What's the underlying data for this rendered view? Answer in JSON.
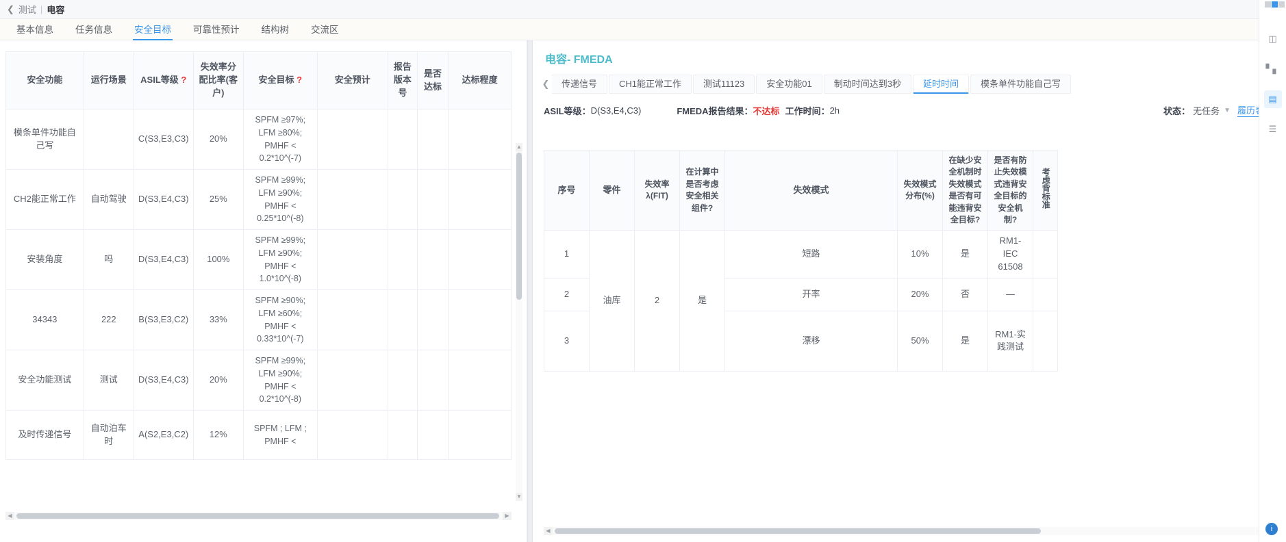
{
  "breadcrumb": {
    "back_icon": "chevron-left-icon",
    "parent": "测试",
    "sep": "|",
    "current": "电容"
  },
  "main_tabs": [
    {
      "label": "基本信息",
      "active": false
    },
    {
      "label": "任务信息",
      "active": false
    },
    {
      "label": "安全目标",
      "active": true
    },
    {
      "label": "可靠性预计",
      "active": false
    },
    {
      "label": "结构树",
      "active": false
    },
    {
      "label": "交流区",
      "active": false
    }
  ],
  "left_table": {
    "headers": [
      {
        "label": "安全功能",
        "help": false
      },
      {
        "label": "运行场景",
        "help": false
      },
      {
        "label": "ASIL等级",
        "help": true
      },
      {
        "label": "失效率分配比率(客户)",
        "help": false
      },
      {
        "label": "安全目标",
        "help": true
      },
      {
        "label": "安全预计",
        "help": false
      },
      {
        "label": "报告版本号",
        "help": false
      },
      {
        "label": "是否达标",
        "help": false
      },
      {
        "label": "达标程度",
        "help": false
      }
    ],
    "help_glyph": "?",
    "rows": [
      {
        "func": "模条单件功能自己写",
        "scene": "",
        "asil": "C(S3,E3,C3)",
        "ratio": "20%",
        "goal": "SPFM ≥97%; LFM ≥80%; PMHF < 0.2*10^(-7)",
        "estimate": "",
        "version": "",
        "pass": "",
        "degree": ""
      },
      {
        "func": "CH2能正常工作",
        "scene": "自动驾驶",
        "asil": "D(S3,E4,C3)",
        "ratio": "25%",
        "goal": "SPFM ≥99%; LFM ≥90%; PMHF < 0.25*10^(-8)",
        "estimate": "",
        "version": "",
        "pass": "",
        "degree": ""
      },
      {
        "func": "安装角度",
        "scene": "吗",
        "asil": "D(S3,E4,C3)",
        "ratio": "100%",
        "goal": "SPFM ≥99%; LFM ≥90%; PMHF < 1.0*10^(-8)",
        "estimate": "",
        "version": "",
        "pass": "",
        "degree": ""
      },
      {
        "func": "34343",
        "scene": "222",
        "asil": "B(S3,E3,C2)",
        "ratio": "33%",
        "goal": "SPFM ≥90%; LFM ≥60%; PMHF < 0.33*10^(-7)",
        "estimate": "",
        "version": "",
        "pass": "",
        "degree": ""
      },
      {
        "func": "安全功能测试",
        "scene": "测试",
        "asil": "D(S3,E4,C3)",
        "ratio": "20%",
        "goal": "SPFM ≥99%; LFM ≥90%; PMHF < 0.2*10^(-8)",
        "estimate": "",
        "version": "",
        "pass": "",
        "degree": ""
      },
      {
        "func": "及时传递信号",
        "scene": "自动泊车时",
        "asil": "A(S2,E3,C2)",
        "ratio": "12%",
        "goal": "SPFM ; LFM ; PMHF <",
        "estimate": "",
        "version": "",
        "pass": "",
        "degree": ""
      }
    ],
    "vscroll": {
      "up_icon": "caret-up-icon",
      "down_icon": "caret-down-icon"
    },
    "hscroll": {
      "left_icon": "caret-left-icon",
      "right_icon": "caret-right-icon"
    }
  },
  "right_panel": {
    "title": "电容- FMEDA",
    "tabs_prev_icon": "chevron-left-icon",
    "tabs_next_icon": "chevron-right-icon",
    "tabs": [
      {
        "label": "传递信号",
        "active": false,
        "clipped": true
      },
      {
        "label": "CH1能正常工作",
        "active": false
      },
      {
        "label": "测试11123",
        "active": false
      },
      {
        "label": "安全功能01",
        "active": false
      },
      {
        "label": "制动时间达到3秒",
        "active": false
      },
      {
        "label": "延时时间",
        "active": true
      },
      {
        "label": "模条单件功能自己写",
        "active": false
      }
    ],
    "meta": {
      "asil_label": "ASIL等级：",
      "asil_value": "D(S3,E4,C3)",
      "fmeda_label": "FMEDA报告结果：",
      "fmeda_value": "不达标",
      "worktime_label": "工作时间：",
      "worktime_value": "2h",
      "status_label": "状态：",
      "status_value": "无任务",
      "status_caret_icon": "chevron-down-icon",
      "history_link": "履历表"
    },
    "collapse_icon": "caret-up-circle-icon",
    "table": {
      "headers": [
        "序号",
        "零件",
        "失效率λ(FIT)",
        "在计算中是否考虑安全相关组件?",
        "失效模式",
        "失效模式分布(%)",
        "在缺少安全机制时失效模式是否有可能违背安全目标?",
        "是否有防止失效模式违背安全目标的安全机制?",
        "考虑背标准"
      ],
      "rows": [
        {
          "idx": "1",
          "part": "油库",
          "fit": "2",
          "consider": "是",
          "mode": "短路",
          "dist": "10%",
          "violate": "是",
          "mechanism": "RM1-IEC 61508",
          "extra": ""
        },
        {
          "idx": "2",
          "part": "",
          "fit": "",
          "consider": "",
          "mode": "开率",
          "dist": "20%",
          "violate": "否",
          "mechanism": "—",
          "extra": ""
        },
        {
          "idx": "3",
          "part": "",
          "fit": "",
          "consider": "",
          "mode": "漂移",
          "dist": "50%",
          "violate": "是",
          "mechanism": "RM1-实践测试",
          "extra": ""
        }
      ]
    },
    "hscroll": {
      "left_icon": "caret-left-icon",
      "right_icon": "caret-right-icon"
    }
  },
  "rail": {
    "icons": [
      {
        "name": "cube-icon",
        "glyph": "◳",
        "active": false
      },
      {
        "name": "grid-apps-icon",
        "glyph": "⠿",
        "active": false
      },
      {
        "name": "panel-icon",
        "glyph": "▤",
        "active": true
      },
      {
        "name": "list-icon",
        "glyph": "☰",
        "active": false
      }
    ],
    "help_fab": "i"
  }
}
